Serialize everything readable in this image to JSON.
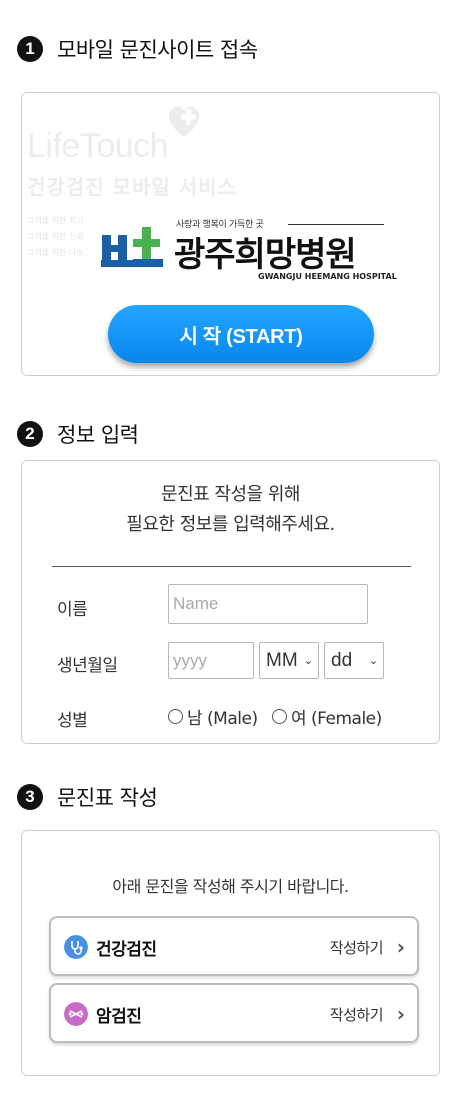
{
  "steps": [
    {
      "number": "1",
      "title": "모바일 문진사이트 접속"
    },
    {
      "number": "2",
      "title": "정보 입력"
    },
    {
      "number": "3",
      "title": "문진표 작성"
    }
  ],
  "intro_card": {
    "brand": "LifeTouch",
    "brand_sub": "건강검진 모바일 서비스",
    "faint_lines": [
      "고객을 위한 최고",
      "고객을 위한 신뢰",
      "고객을 위한 나눔"
    ],
    "hospital_tagline": "사랑과 행복이 가득한 곳",
    "hospital_name": "광주희망병원",
    "hospital_name_en": "GWANGJU HEEMANG HOSPITAL",
    "start_button": "시 작 (START)"
  },
  "info_form": {
    "intro_line1": "문진표 작성을 위해",
    "intro_line2": "필요한 정보를 입력해주세요.",
    "name_label": "이름",
    "name_placeholder": "Name",
    "birth_label": "생년월일",
    "year_placeholder": "yyyy",
    "month_value": "MM",
    "day_value": "dd",
    "gender_label": "성별",
    "male_label": "남 (Male)",
    "female_label": "여 (Female)"
  },
  "questionnaire": {
    "intro": "아래 문진을 작성해 주시기 바랍니다.",
    "items": [
      {
        "name": "건강검진",
        "action": "작성하기",
        "icon": "stethoscope-icon",
        "color": "#4a90e2"
      },
      {
        "name": "암검진",
        "action": "작성하기",
        "icon": "dna-icon",
        "color": "#c86ac8"
      }
    ]
  },
  "colors": {
    "accent": "#1098f7",
    "logo_blue": "#1a5fa8",
    "logo_green": "#4caf50"
  }
}
